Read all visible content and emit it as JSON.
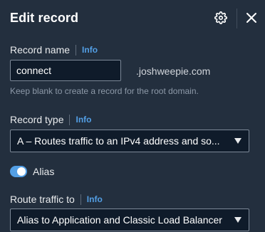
{
  "header": {
    "title": "Edit record"
  },
  "record_name": {
    "label": "Record name",
    "info": "Info",
    "value": "connect",
    "domain_suffix": ".joshweepie.com",
    "hint": "Keep blank to create a record for the root domain."
  },
  "record_type": {
    "label": "Record type",
    "info": "Info",
    "selected": "A – Routes traffic to an IPv4 address and so..."
  },
  "alias": {
    "label": "Alias",
    "enabled": true
  },
  "route_traffic": {
    "label": "Route traffic to",
    "info": "Info",
    "selected": "Alias to Application and Classic Load Balancer"
  },
  "colors": {
    "background": "#232f3e",
    "input_background": "#0f1b2a",
    "accent": "#539fe5",
    "border": "#7d8998"
  },
  "icons": {
    "settings": "gear-icon",
    "close": "close-icon",
    "dropdown": "caret-down-icon"
  }
}
